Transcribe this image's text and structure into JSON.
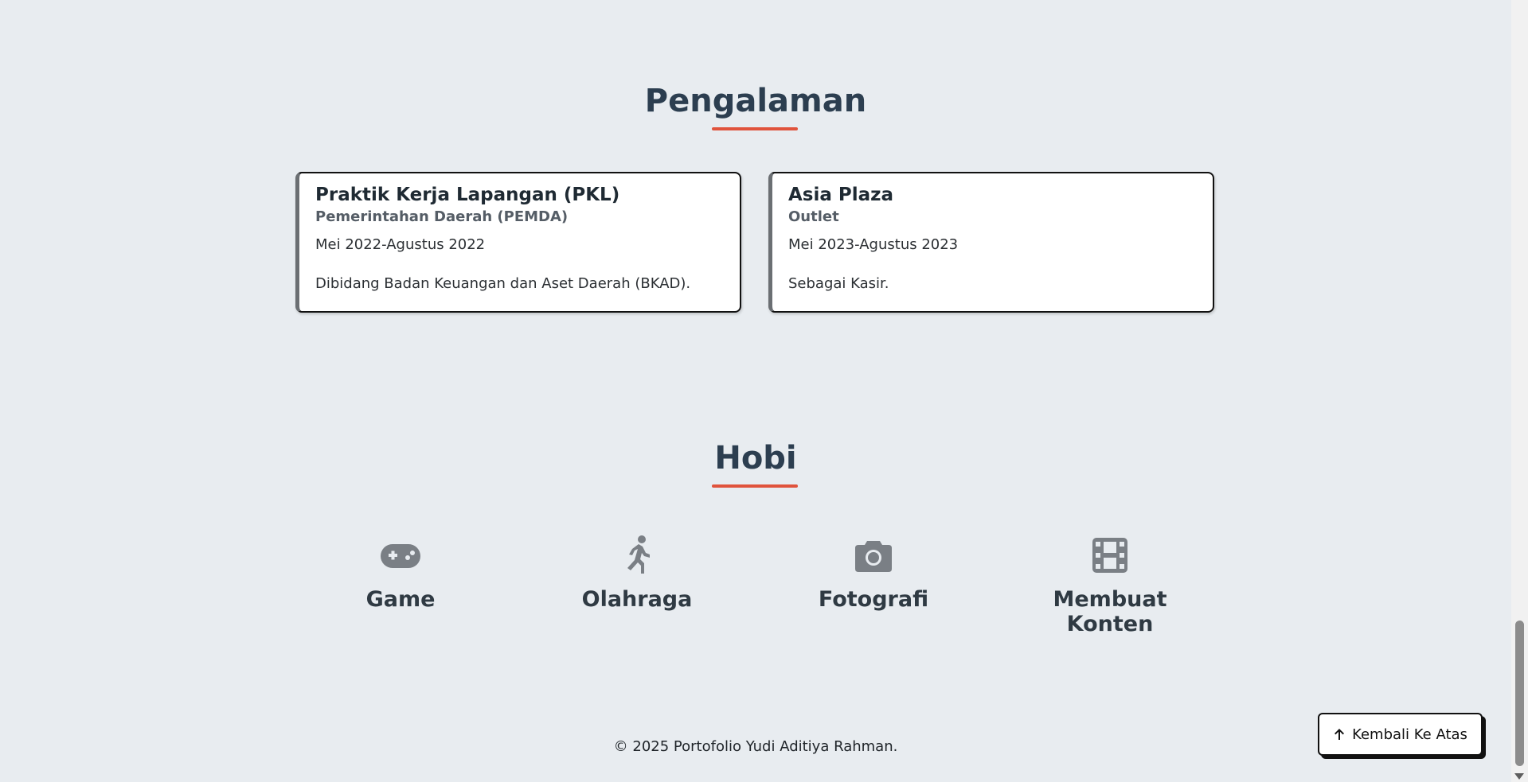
{
  "experience": {
    "title": "Pengalaman",
    "items": [
      {
        "role": "Praktik Kerja Lapangan (PKL)",
        "org": "Pemerintahan Daerah (PEMDA)",
        "period": "Mei 2022-Agustus 2022",
        "desc": "Dibidang Badan Keuangan dan Aset Daerah (BKAD)."
      },
      {
        "role": "Asia Plaza",
        "org": "Outlet",
        "period": "Mei 2023-Agustus 2023",
        "desc": "Sebagai Kasir."
      }
    ]
  },
  "hobbies": {
    "title": "Hobi",
    "items": [
      {
        "label": "Game",
        "icon": "gamepad-icon"
      },
      {
        "label": "Olahraga",
        "icon": "running-person-icon"
      },
      {
        "label": "Fotografi",
        "icon": "camera-icon"
      },
      {
        "label": "Membuat Konten",
        "icon": "film-icon"
      }
    ]
  },
  "footer": {
    "text": "© 2025 Portofolio Yudi Aditiya Rahman."
  },
  "back_to_top": {
    "label": "Kembali Ke Atas",
    "icon": "arrow-up-icon"
  },
  "colors": {
    "accent": "#e0533c",
    "background": "#e8ecf0",
    "icon_gray": "#7a7f85"
  }
}
